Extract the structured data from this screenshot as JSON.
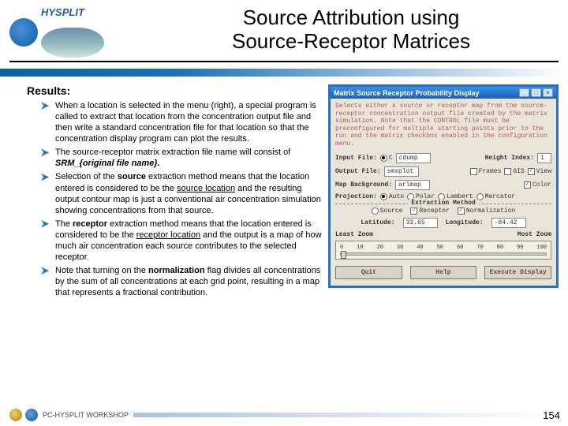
{
  "header": {
    "logo_label": "HYSPLIT",
    "title_l1": "Source Attribution using",
    "title_l2": "Source-Receptor Matrices"
  },
  "results_heading": "Results:",
  "bullets": {
    "b1": "When a location is selected in the menu (right), a special program is called to extract that location from the concentration output file and then write a standard concentration file for that location so that the concentration display program can plot the results.",
    "b2_pre": "The source-receptor matrix extraction file name will consist of ",
    "b2_em": "SRM_{original file name}.",
    "b3_pre": "Selection of the ",
    "b3_bold": "source",
    "b3_mid1": " extraction method means that the location entered is considered to be the ",
    "b3_u1": "source location",
    "b3_mid2": " and the resulting output contour map is just a conventional air concentration simulation showing concentrations from that source.",
    "b4_pre": "The ",
    "b4_bold": "receptor",
    "b4_mid1": " extraction method means that the location entered is considered to be the ",
    "b4_u1": "receptor location",
    "b4_mid2": " and the output is a map of how much air concentration each source contributes to the selected receptor.",
    "b5_pre": "Note that turning on the ",
    "b5_bold": "normalization",
    "b5_post": " flag divides all concentrations by the sum of all concentrations at each grid point, resulting in a map that represents a fractional contribution."
  },
  "dialog": {
    "title": "Matrix Source Receptor Probability Display",
    "instr": "Selects either a source or receptor map from the source-receptor concentration output file created by the matrix simulation. Note that the CONTROL file must be preconfigured for multiple starting points prior to the run and the matrix checkbox enabled in the configuration menu.",
    "input_file_label": "Input File:",
    "input_file_type": "C",
    "input_file_value": "cdump",
    "height_label": "Height Index:",
    "height_value": "1",
    "output_file_label": "Output File:",
    "output_file_value": "smxplot",
    "display_frames": "Frames",
    "display_gis": "GIS",
    "display_view": "View",
    "map_bg_label": "Map Background:",
    "map_bg_value": "arlmap",
    "color_label": "Color",
    "proj_label": "Projection:",
    "proj_auto": "Auto",
    "proj_polar": "Polar",
    "proj_lambert": "Lambert",
    "proj_mercator": "Mercator",
    "extract_heading": "Extraction Method",
    "ext_source": "Source",
    "ext_receptor": "Receptor",
    "ext_norm": "Normalization",
    "lat_label": "Latitude:",
    "lat_value": "33.65",
    "lon_label": "Longitude:",
    "lon_value": "-84.42",
    "zoom_least": "Least Zoom",
    "zoom_most": "Most Zoom",
    "slider_ticks": [
      "0",
      "10",
      "20",
      "30",
      "40",
      "50",
      "60",
      "70",
      "80",
      "90",
      "100"
    ],
    "btn_quit": "Quit",
    "btn_help": "Help",
    "btn_exec": "Execute Display"
  },
  "footer": {
    "text": "PC-HYSPLIT WORKSHOP",
    "page": "154"
  }
}
